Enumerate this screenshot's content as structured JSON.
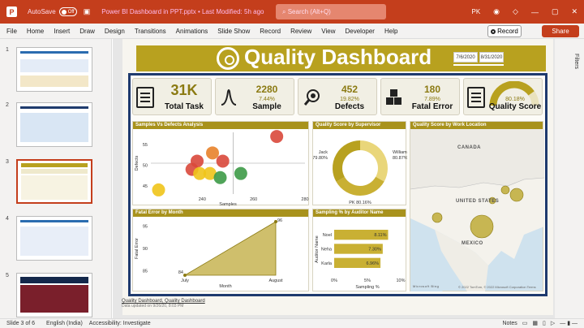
{
  "titlebar": {
    "autosave_label": "AutoSave",
    "autosave_state": "Off",
    "doc_title": "Power BI Dashboard in PPT.pptx • Last Modified: 5h ago",
    "search_placeholder": "Search (Alt+Q)",
    "user_initials": "PK"
  },
  "menu": {
    "items": [
      "File",
      "Home",
      "Insert",
      "Draw",
      "Design",
      "Transitions",
      "Animations",
      "Slide Show",
      "Record",
      "Review",
      "View",
      "Developer",
      "Help"
    ],
    "record_label": "Record",
    "share_label": "Share"
  },
  "thumbnails": {
    "numbers": [
      "1",
      "2",
      "3",
      "4",
      "5"
    ],
    "active_index": 2
  },
  "dashboard": {
    "title": "Quality Dashboard",
    "date_start": "7/6/2020",
    "date_end": "8/31/2020",
    "kpis": [
      {
        "value": "31K",
        "pct": "",
        "label": "Total Task"
      },
      {
        "value": "2280",
        "pct": "7.44%",
        "label": "Sample"
      },
      {
        "value": "452",
        "pct": "19.82%",
        "label": "Defects"
      },
      {
        "value": "180",
        "pct": "7.89%",
        "label": "Fatal Error"
      },
      {
        "value": "",
        "pct": "80.18%",
        "label": "Quality Score"
      }
    ],
    "panels": {
      "samples_defects": "Samples Vs Defects Analysis",
      "quality_supervisor": "Quality Score by Supervisor",
      "quality_location": "Quality Score by Work Location",
      "fatal_month": "Fatal Error by Month",
      "sampling_auditor": "Sampling % by Auditor Name"
    },
    "filters_label": "Filters",
    "map_labels": {
      "canada": "CANADA",
      "us": "UNITED STATES",
      "mexico": "MEXICO",
      "credit": "© 2022 TomTom, © 2022 Microsoft Corporation  Terms",
      "logo": "Microsoft Bing"
    },
    "footnote_link": "Quality Dashboard, Quality Dashboard",
    "footnote_sub": "Data updated on 9/26/20, 8:03 PM"
  },
  "statusbar": {
    "slide_info": "Slide 3 of 6",
    "language": "English (India)",
    "accessibility": "Accessibility: Investigate",
    "notes": "Notes"
  },
  "colors": {
    "brand": "#c43e1c",
    "gold": "#b8a11f",
    "navy": "#1e3a6e",
    "bubble_red": "#d9483b",
    "bubble_green": "#3d9a47",
    "bubble_yellow": "#f0c419",
    "bubble_orange": "#e8822a"
  },
  "chart_data": [
    {
      "type": "scatter",
      "title": "Samples Vs Defects Analysis",
      "xlabel": "Samples",
      "ylabel": "Defects",
      "xlim": [
        220,
        280
      ],
      "ylim": [
        43,
        58
      ],
      "x_ticks": [
        "240",
        "260",
        "280"
      ],
      "y_ticks": [
        "45",
        "50",
        "55"
      ],
      "points": [
        {
          "x": 238,
          "y": 51,
          "color": "red"
        },
        {
          "x": 248,
          "y": 51,
          "color": "red"
        },
        {
          "x": 236,
          "y": 49,
          "color": "red"
        },
        {
          "x": 239,
          "y": 48,
          "color": "yellow"
        },
        {
          "x": 243,
          "y": 48,
          "color": "yellow"
        },
        {
          "x": 244,
          "y": 53,
          "color": "orange"
        },
        {
          "x": 247,
          "y": 47,
          "color": "green"
        },
        {
          "x": 255,
          "y": 48,
          "color": "green"
        },
        {
          "x": 269,
          "y": 57,
          "color": "red"
        },
        {
          "x": 223,
          "y": 44,
          "color": "yellow"
        }
      ]
    },
    {
      "type": "pie",
      "title": "Quality Score by Supervisor",
      "labels": [
        "Jack",
        "William",
        "PK"
      ],
      "values": [
        79.8,
        80.87,
        80.16
      ],
      "data_labels": [
        "Jack 79.80%",
        "William 80.87%",
        "PK 80.16%"
      ]
    },
    {
      "type": "area",
      "title": "Fatal Error by Month",
      "xlabel": "Month",
      "ylabel": "Fatal Error",
      "categories": [
        "July",
        "August"
      ],
      "values": [
        84,
        96
      ],
      "ylim": [
        84,
        96
      ],
      "y_ticks": [
        "85",
        "90",
        "95"
      ]
    },
    {
      "type": "bar",
      "title": "Sampling % by Auditor Name",
      "xlabel": "Sampling %",
      "ylabel": "Auditor Name",
      "categories": [
        "Noel",
        "Neha",
        "Karla"
      ],
      "values": [
        8.11,
        7.3,
        6.96
      ],
      "data_labels": [
        "8.11%",
        "7.30%",
        "6.96%"
      ],
      "xlim": [
        0,
        10
      ],
      "x_ticks": [
        "0%",
        "5%",
        "10%"
      ]
    }
  ]
}
